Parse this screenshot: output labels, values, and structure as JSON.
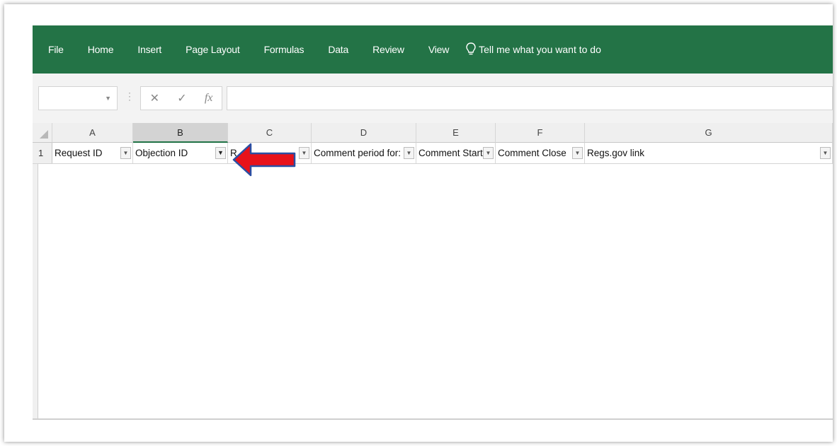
{
  "ribbon": {
    "tabs": [
      "File",
      "Home",
      "Insert",
      "Page Layout",
      "Formulas",
      "Data",
      "Review",
      "View"
    ],
    "tell_me": "Tell me what you want to do",
    "color": "#237346"
  },
  "formula_bar": {
    "cancel": "✕",
    "enter": "✓",
    "fx": "fx"
  },
  "columns": [
    "A",
    "B",
    "C",
    "D",
    "E",
    "F",
    "G"
  ],
  "row1": {
    "number": "1",
    "cells": [
      "Request ID",
      "Objection ID",
      "R",
      "Comment period for:",
      "Comment Start",
      "Comment Close",
      "Regs.gov link"
    ]
  },
  "annotation": {
    "arrow_color": "#e8121b",
    "arrow_outline": "#2b4fa3"
  }
}
